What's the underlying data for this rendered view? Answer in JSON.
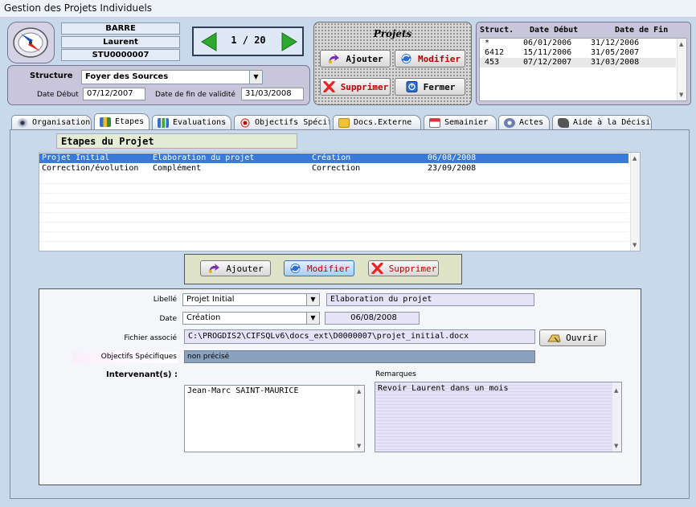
{
  "window": {
    "title": "Gestion des Projets Individuels"
  },
  "person": {
    "last_name": "BARRE",
    "first_name": "Laurent",
    "id": "STU0000007"
  },
  "nav": {
    "counter": "1 / 20"
  },
  "structure": {
    "label": "Structure",
    "value": "Foyer des Sources",
    "date_debut_label": "Date Début",
    "date_debut": "07/12/2007",
    "date_fin_label": "Date de fin de validité",
    "date_fin": "31/03/2008"
  },
  "projets": {
    "title": "Projets",
    "ajouter": "Ajouter",
    "modifier": "Modifier",
    "supprimer": "Supprimer",
    "fermer": "Fermer"
  },
  "struct_table": {
    "headers": [
      "Struct.",
      "Date Début",
      "Date de Fin"
    ],
    "rows": [
      {
        "struct": "*",
        "debut": "06/01/2006",
        "fin": "31/12/2006"
      },
      {
        "struct": "6412",
        "debut": "15/11/2006",
        "fin": "31/05/2007"
      },
      {
        "struct": "453",
        "debut": "07/12/2007",
        "fin": "31/03/2008"
      }
    ]
  },
  "tabs": [
    {
      "label": "Organisation"
    },
    {
      "label": "Etapes"
    },
    {
      "label": "Evaluations"
    },
    {
      "label": "Objectifs Spécifi"
    },
    {
      "label": "Docs.Externe"
    },
    {
      "label": "Semainier"
    },
    {
      "label": "Actes"
    },
    {
      "label": "Aide à la Décision"
    }
  ],
  "etapes": {
    "title": "Etapes du Projet",
    "rows": [
      {
        "libelle": "Projet Initial",
        "description": "Elaboration du projet",
        "type": "Création",
        "date": "06/08/2008"
      },
      {
        "libelle": "Correction/évolution",
        "description": "Complément",
        "type": "Correction",
        "date": "23/09/2008"
      }
    ],
    "ajouter": "Ajouter",
    "modifier": "Modifier",
    "supprimer": "Supprimer"
  },
  "detail": {
    "libelle_label": "Libellé",
    "libelle_value": "Projet Initial",
    "libelle_desc": "Elaboration du projet",
    "date_label": "Date",
    "date_type": "Création",
    "date_value": "06/08/2008",
    "fichier_label": "Fichier associé",
    "fichier_value": "C:\\PROGDIS2\\CIFSQLv6\\docs_ext\\D0000007\\projet_initial.docx",
    "ouvrir": "Ouvrir",
    "objectifs_label": "Objectifs Spécifiques",
    "objectifs_value": "non précisé",
    "intervenants_label": "Intervenant(s) :",
    "intervenants": [
      "Jean-Marc SAINT-MAURICE"
    ],
    "remarques_label": "Remarques",
    "remarques_value": "Revoir Laurent dans un mois"
  },
  "colors": {
    "window_bg": "#c7d9ea",
    "panel_bg": "#c9c6dc",
    "selection": "#3a7ad8",
    "nav_arrow": "#2ea82e",
    "modifier_text": "#c00000"
  }
}
